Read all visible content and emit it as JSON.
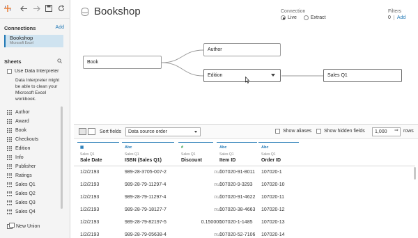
{
  "toolbar": {
    "icons": [
      "tableau-logo-icon",
      "back-arrow-icon",
      "forward-arrow-icon",
      "save-icon",
      "refresh-icon"
    ]
  },
  "connections": {
    "title": "Connections",
    "add_label": "Add",
    "item": {
      "name": "Bookshop",
      "type": "Microsoft Excel"
    }
  },
  "sheets": {
    "title": "Sheets",
    "interpreter_label": "Use Data Interpreter",
    "interpreter_desc": "Data Interpreter might be able to clean your Microsoft Excel workbook.",
    "items": [
      "Author",
      "Award",
      "Book",
      "Checkouts",
      "Edition",
      "Info",
      "Publisher",
      "Ratings",
      "Sales Q1",
      "Sales Q2",
      "Sales Q3",
      "Sales Q4"
    ],
    "new_union": "New Union"
  },
  "header": {
    "title": "Bookshop",
    "connection_label": "Connection",
    "live_label": "Live",
    "extract_label": "Extract",
    "filters_label": "Filters",
    "filters_count": "0",
    "filters_add": "Add"
  },
  "canvas": {
    "book": "Book",
    "author": "Author",
    "edition": "Edition",
    "sales": "Sales Q1"
  },
  "grid": {
    "sort_label": "Sort fields",
    "sort_value": "Data source order",
    "show_aliases": "Show aliases",
    "show_hidden": "Show hidden fields",
    "rows_value": "1,000",
    "rows_label": "rows",
    "columns": [
      {
        "type": "date-icon",
        "type_text": "▦",
        "source": "Sales Q1",
        "name": "Sale Date"
      },
      {
        "type": "string-icon",
        "type_text": "Abc",
        "source": "Sales Q1",
        "name": "ISBN (Sales Q1)"
      },
      {
        "type": "number-icon",
        "type_text": "#",
        "source": "Sales Q1",
        "name": "Discount"
      },
      {
        "type": "string-icon",
        "type_text": "Abc",
        "source": "Sales Q1",
        "name": "Item ID"
      },
      {
        "type": "string-icon",
        "type_text": "Abc",
        "source": "Sales Q1",
        "name": "Order ID"
      }
    ],
    "rows": [
      [
        "1/2/2193",
        "989-28-3705-007-2",
        "null",
        "107020-91-8011",
        "107020-1"
      ],
      [
        "1/2/2193",
        "989-28-79-11297-4",
        "null",
        "107020-9-3293",
        "107020-10"
      ],
      [
        "1/2/2193",
        "989-28-79-11297-4",
        "null",
        "107020-91-4622",
        "107020-11"
      ],
      [
        "1/2/2193",
        "989-28-79-18127-7",
        "null",
        "107020-38-4663",
        "107020-12"
      ],
      [
        "1/2/2193",
        "989-28-79-82197-5",
        "0.150000",
        "107020-1-1485",
        "107020-13"
      ],
      [
        "1/2/2193",
        "989-28-79-05638-4",
        "null",
        "107020-52-7106",
        "107020-14"
      ]
    ]
  }
}
